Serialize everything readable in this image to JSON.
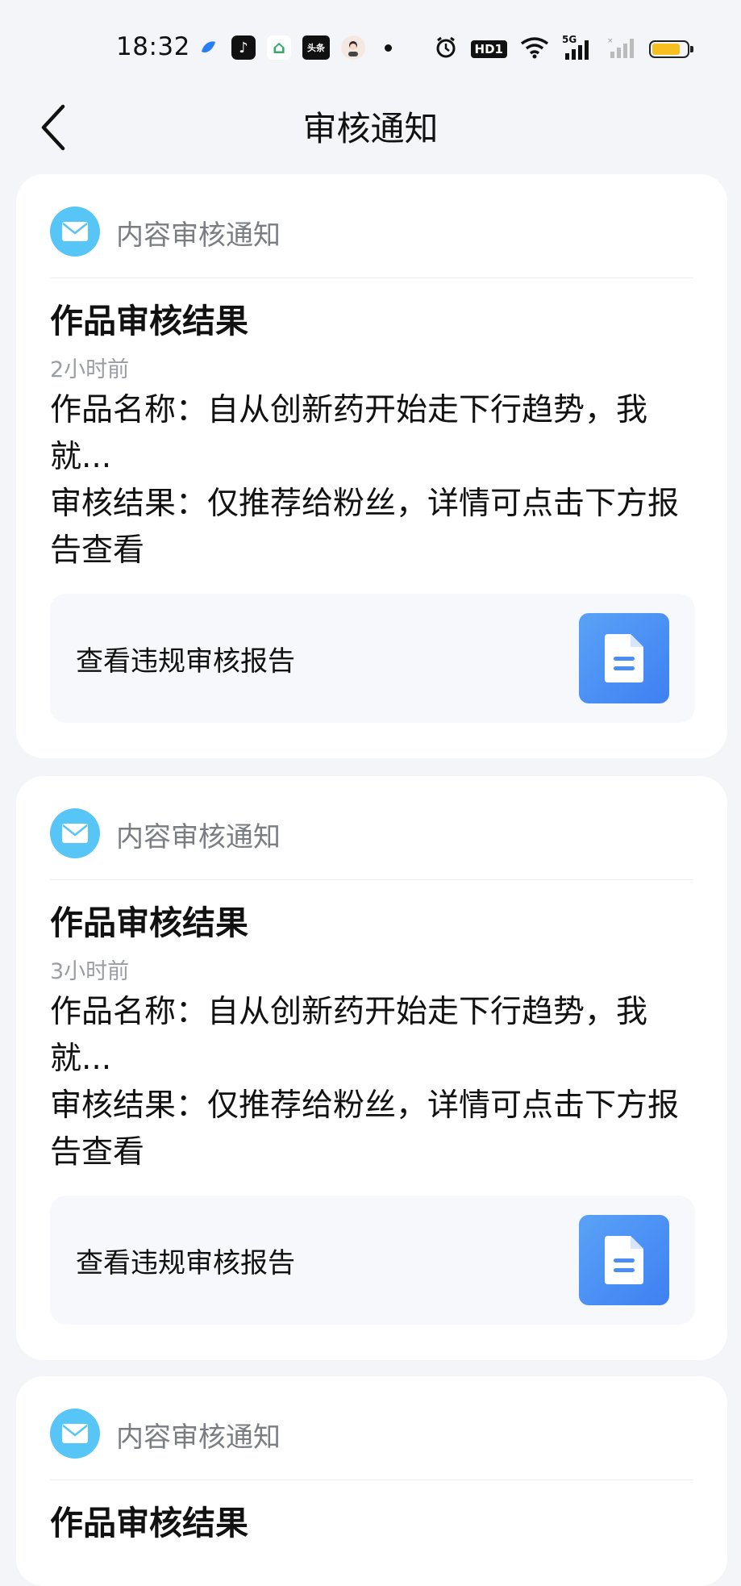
{
  "status_bar": {
    "time": "18:32",
    "apps": [
      {
        "name": "blue-app-icon",
        "glyph": "",
        "bg": "#ffffff",
        "fg": "#2a7ef5"
      },
      {
        "name": "douyin-app-icon",
        "glyph": "♪",
        "bg": "#111111",
        "fg": "#ffffff"
      },
      {
        "name": "home-ai-app-icon",
        "glyph": "⌂",
        "bg": "#ffffff",
        "fg": "#3aa86b"
      },
      {
        "name": "toutiao-app-icon",
        "glyph": "头条",
        "bg": "#111111",
        "fg": "#ffffff"
      },
      {
        "name": "avatar-app-icon",
        "glyph": "☺",
        "bg": "#f4e9e2",
        "fg": "#333333"
      }
    ],
    "hd_label": "HD1",
    "signal_label": "5G",
    "battery_level": 0.8,
    "battery_color": "#f6c023"
  },
  "header": {
    "title": "审核通知"
  },
  "cards": [
    {
      "category": "内容审核通知",
      "title": "作品审核结果",
      "time": "2小时前",
      "name_line": "作品名称：自从创新药开始走下行趋势，我就...",
      "result_line": "审核结果：仅推荐给粉丝，详情可点击下方报告查看",
      "report_label": "查看违规审核报告"
    },
    {
      "category": "内容审核通知",
      "title": "作品审核结果",
      "time": "3小时前",
      "name_line": "作品名称：自从创新药开始走下行趋势，我就...",
      "result_line": "审核结果：仅推荐给粉丝，详情可点击下方报告查看",
      "report_label": "查看违规审核报告"
    },
    {
      "category": "内容审核通知",
      "title": "作品审核结果"
    }
  ],
  "colors": {
    "page_bg": "#f3f5f9",
    "mail_icon_bg": "#57c5f5",
    "report_icon_bg": "#4a8ef5"
  }
}
